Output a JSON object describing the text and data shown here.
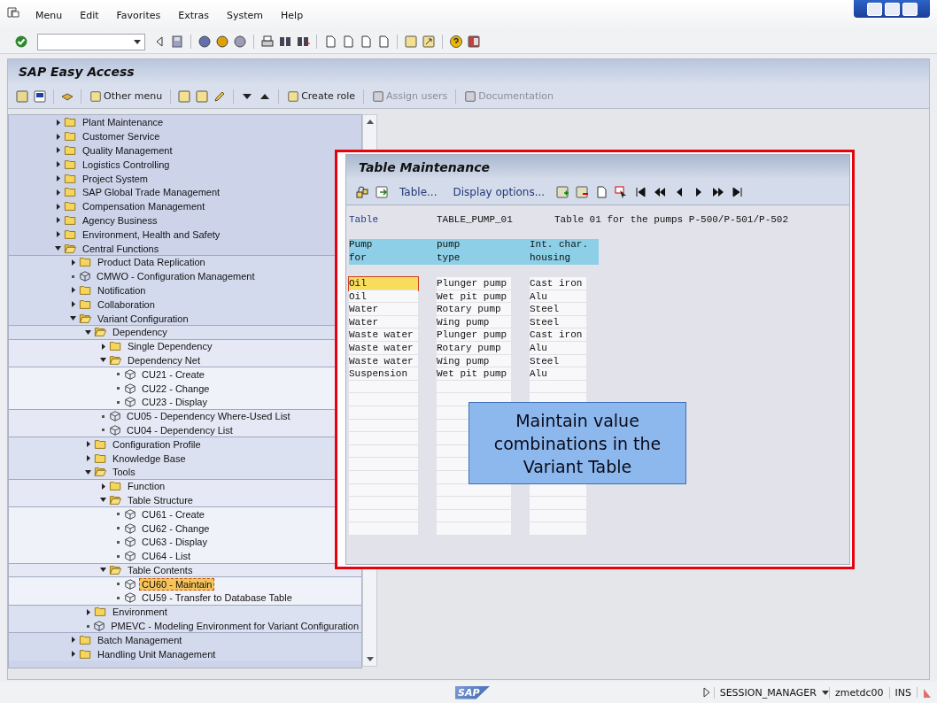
{
  "menu_bar": {
    "items": [
      "Menu",
      "Edit",
      "Favorites",
      "Extras",
      "System",
      "Help"
    ]
  },
  "screen": {
    "title": "SAP Easy Access"
  },
  "app_toolbar": {
    "buttons": [
      {
        "label": "Other menu",
        "disabled": false
      },
      {
        "label": "Create role",
        "disabled": false
      },
      {
        "label": "Assign users",
        "disabled": true
      },
      {
        "label": "Documentation",
        "disabled": true
      }
    ]
  },
  "tree": [
    {
      "label": "Plant Maintenance",
      "kind": "folder",
      "expanded": false,
      "selected": false
    },
    {
      "label": "Customer Service",
      "kind": "folder",
      "expanded": false,
      "selected": false
    },
    {
      "label": "Quality Management",
      "kind": "folder",
      "expanded": false,
      "selected": false
    },
    {
      "label": "Logistics Controlling",
      "kind": "folder",
      "expanded": false,
      "selected": false
    },
    {
      "label": "Project System",
      "kind": "folder",
      "expanded": false,
      "selected": false
    },
    {
      "label": "SAP Global Trade Management",
      "kind": "folder",
      "expanded": false,
      "selected": false
    },
    {
      "label": "Compensation Management",
      "kind": "folder",
      "expanded": false,
      "selected": false
    },
    {
      "label": "Agency Business",
      "kind": "folder",
      "expanded": false,
      "selected": false
    },
    {
      "label": "Environment, Health and Safety",
      "kind": "folder",
      "expanded": false,
      "selected": false
    },
    {
      "label": "Central Functions",
      "kind": "folder",
      "expanded": true,
      "selected": false,
      "children": [
        {
          "label": "Product Data Replication",
          "kind": "folder",
          "expanded": false,
          "selected": false
        },
        {
          "label": "CMWO - Configuration Management",
          "kind": "transaction",
          "selected": false
        },
        {
          "label": "Notification",
          "kind": "folder",
          "expanded": false,
          "selected": false
        },
        {
          "label": "Collaboration",
          "kind": "folder",
          "expanded": false,
          "selected": false
        },
        {
          "label": "Variant Configuration",
          "kind": "folder",
          "expanded": true,
          "selected": false,
          "children": [
            {
              "label": "Dependency",
              "kind": "folder",
              "expanded": true,
              "selected": false,
              "children": [
                {
                  "label": "Single Dependency",
                  "kind": "folder",
                  "expanded": false,
                  "selected": false
                },
                {
                  "label": "Dependency Net",
                  "kind": "folder",
                  "expanded": true,
                  "selected": false,
                  "children": [
                    {
                      "label": "CU21 - Create",
                      "kind": "transaction",
                      "selected": false
                    },
                    {
                      "label": "CU22 - Change",
                      "kind": "transaction",
                      "selected": false
                    },
                    {
                      "label": "CU23 - Display",
                      "kind": "transaction",
                      "selected": false
                    }
                  ]
                },
                {
                  "label": "CU05 - Dependency Where-Used List",
                  "kind": "transaction",
                  "selected": false
                },
                {
                  "label": "CU04 - Dependency List",
                  "kind": "transaction",
                  "selected": false
                }
              ]
            },
            {
              "label": "Configuration Profile",
              "kind": "folder",
              "expanded": false,
              "selected": false
            },
            {
              "label": "Knowledge Base",
              "kind": "folder",
              "expanded": false,
              "selected": false
            },
            {
              "label": "Tools",
              "kind": "folder",
              "expanded": true,
              "selected": false,
              "children": [
                {
                  "label": "Function",
                  "kind": "folder",
                  "expanded": false,
                  "selected": false
                },
                {
                  "label": "Table Structure",
                  "kind": "folder",
                  "expanded": true,
                  "selected": false,
                  "children": [
                    {
                      "label": "CU61 - Create",
                      "kind": "transaction",
                      "selected": false
                    },
                    {
                      "label": "CU62 - Change",
                      "kind": "transaction",
                      "selected": false
                    },
                    {
                      "label": "CU63 - Display",
                      "kind": "transaction",
                      "selected": false
                    },
                    {
                      "label": "CU64 - List",
                      "kind": "transaction",
                      "selected": false
                    }
                  ]
                },
                {
                  "label": "Table Contents",
                  "kind": "folder",
                  "expanded": true,
                  "selected": false,
                  "children": [
                    {
                      "label": "CU60 - Maintain",
                      "kind": "transaction",
                      "selected": true
                    },
                    {
                      "label": "CU59 - Transfer to Database Table",
                      "kind": "transaction",
                      "selected": false
                    }
                  ]
                }
              ]
            },
            {
              "label": "Environment",
              "kind": "folder",
              "expanded": false,
              "selected": false
            },
            {
              "label": "PMEVC - Modeling Environment for Variant Configuration",
              "kind": "transaction",
              "selected": false
            }
          ]
        },
        {
          "label": "Batch Management",
          "kind": "folder",
          "expanded": false,
          "selected": false
        },
        {
          "label": "Handling Unit Management",
          "kind": "folder",
          "expanded": false,
          "selected": false
        }
      ]
    }
  ],
  "dialog": {
    "title": "Table Maintenance",
    "toolbar_buttons": [
      "Table...",
      "Display options..."
    ],
    "table_label": "Table",
    "table_name": "TABLE_PUMP_01",
    "table_description": "Table 01 for the pumps P-500/P-501/P-502",
    "header_rows": [
      [
        "Pump",
        "pump",
        "Int. char."
      ],
      [
        "for",
        "type",
        "housing"
      ]
    ],
    "rows": [
      {
        "cells": [
          "Oil",
          "Plunger pump",
          "Cast iron"
        ],
        "focused": true
      },
      {
        "cells": [
          "Oil",
          "Wet pit pump",
          "Alu"
        ],
        "focused": false
      },
      {
        "cells": [
          "Water",
          "Rotary pump",
          "Steel"
        ],
        "focused": false
      },
      {
        "cells": [
          "Water",
          "Wing pump",
          "Steel"
        ],
        "focused": false
      },
      {
        "cells": [
          "Waste water",
          "Plunger pump",
          "Cast iron"
        ],
        "focused": false
      },
      {
        "cells": [
          "Waste water",
          "Rotary pump",
          "Alu"
        ],
        "focused": false
      },
      {
        "cells": [
          "Waste water",
          "Wing pump",
          "Steel"
        ],
        "focused": false
      },
      {
        "cells": [
          "Suspension",
          "Wet pit pump",
          "Alu"
        ],
        "focused": false
      }
    ]
  },
  "callout": {
    "text": "Maintain value combinations in the Variant Table"
  },
  "status_bar": {
    "logo": "SAP",
    "session": "SESSION_MANAGER",
    "server": "zmetdc00",
    "mode": "INS"
  }
}
